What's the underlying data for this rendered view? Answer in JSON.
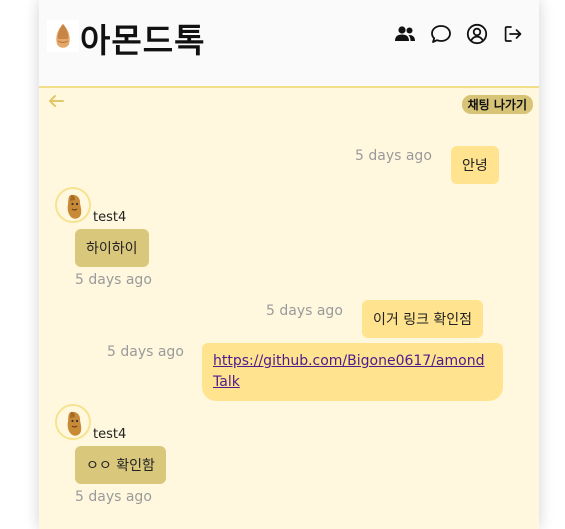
{
  "header": {
    "logo_text": "아몬드톡",
    "nav": [
      {
        "name": "friends-icon"
      },
      {
        "name": "chat-icon"
      },
      {
        "name": "profile-icon"
      },
      {
        "name": "logout-icon"
      }
    ]
  },
  "chat": {
    "leave_label": "채팅 나가기",
    "messages": [
      {
        "sender": "me",
        "text": "안녕",
        "time": "5 days ago"
      },
      {
        "sender": "other",
        "user": "test4",
        "text": "하이하이",
        "time": "5 days ago"
      },
      {
        "sender": "me",
        "text": "이거 링크 확인점",
        "time": "5 days ago"
      },
      {
        "sender": "me",
        "text": "https://github.com/Bigone0617/amondTalk",
        "time": "5 days ago",
        "link": true
      },
      {
        "sender": "other",
        "user": "test4",
        "text": "ㅇㅇ 확인함",
        "time": "5 days ago"
      }
    ]
  },
  "colors": {
    "background": "#fff8df",
    "my_bubble": "#ffe38e",
    "other_bubble": "#d9c77c",
    "accent": "#f3df8a",
    "leave_button": "#d8c476"
  }
}
